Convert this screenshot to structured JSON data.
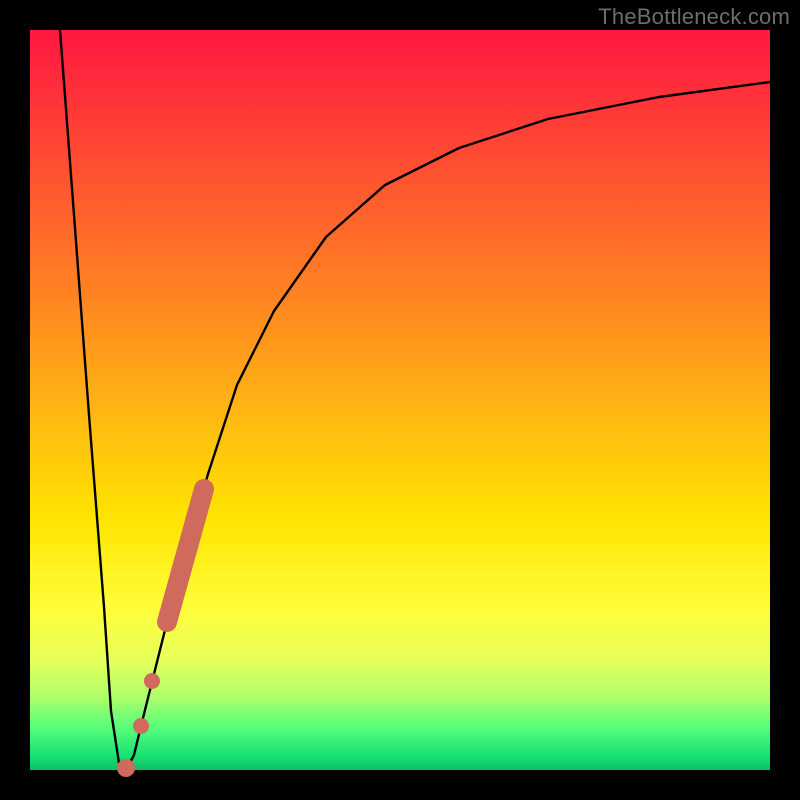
{
  "watermark": "TheBottleneck.com",
  "colors": {
    "curve": "#000000",
    "marker": "#cf6a5c",
    "frame": "#000000"
  },
  "chart_data": {
    "type": "line",
    "title": "",
    "xlabel": "",
    "ylabel": "",
    "xlim": [
      0,
      100
    ],
    "ylim": [
      0,
      100
    ],
    "grid": false,
    "legend": false,
    "annotations": [
      "TheBottleneck.com"
    ],
    "series": [
      {
        "name": "bottleneck-curve",
        "x": [
          4,
          6,
          8,
          10,
          11,
          12,
          13,
          14,
          15,
          17,
          20,
          24,
          28,
          33,
          40,
          48,
          58,
          70,
          85,
          100
        ],
        "y": [
          100,
          75,
          48,
          22,
          8,
          1,
          0,
          2,
          6,
          14,
          26,
          40,
          52,
          62,
          72,
          79,
          84,
          88,
          91,
          93
        ]
      }
    ],
    "markers": [
      {
        "name": "highlight-segment-upper",
        "shape": "thick-line",
        "x": [
          18.5,
          23.5
        ],
        "y": [
          20,
          38
        ]
      },
      {
        "name": "highlight-dot-a",
        "shape": "dot",
        "x": 16.5,
        "y": 12
      },
      {
        "name": "highlight-dot-b",
        "shape": "dot",
        "x": 15.0,
        "y": 6
      },
      {
        "name": "highlight-dot-c",
        "shape": "dot",
        "x": 13.0,
        "y": 0
      }
    ]
  }
}
